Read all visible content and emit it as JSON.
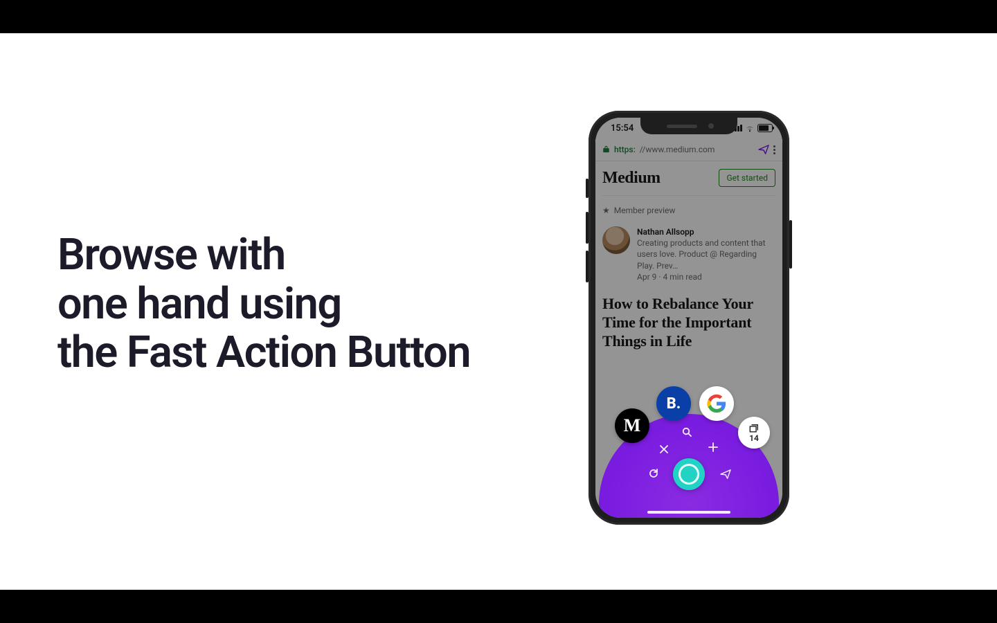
{
  "promo": {
    "line1": "Browse with",
    "line2": "one hand using",
    "line3": "the Fast Action Button"
  },
  "phone": {
    "status": {
      "time": "15:54"
    },
    "urlbar": {
      "scheme": "https:",
      "rest": "//www.medium.com"
    },
    "page": {
      "brand": "Medium",
      "cta": "Get started",
      "member_preview": "Member preview",
      "author": {
        "name": "Nathan Allsopp",
        "bio": "Creating products and content that users love. Product @ Regarding Play. Prev…",
        "meta": "Apr 9 · 4 min read"
      },
      "article_title": "How to Rebalance Your Time for the Important Things in Life"
    },
    "fab": {
      "tabs_count": "14",
      "chips": {
        "medium": "M",
        "booking": "B."
      }
    }
  }
}
